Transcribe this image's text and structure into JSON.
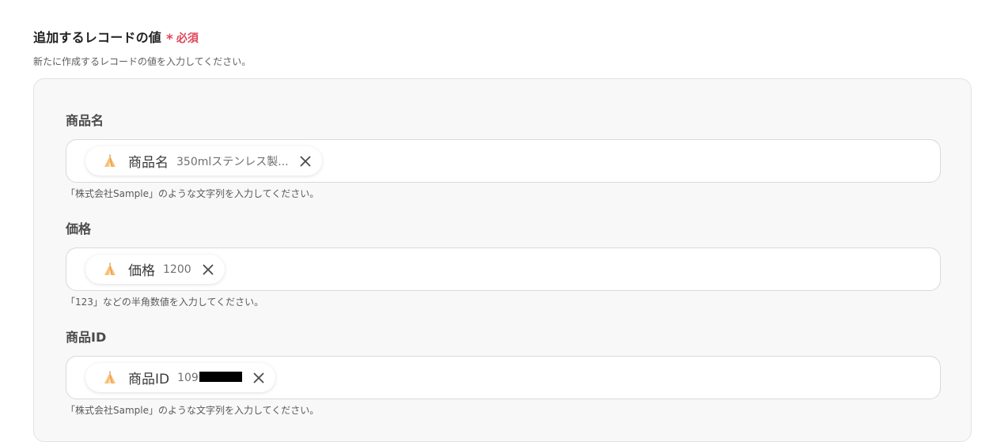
{
  "section": {
    "title": "追加するレコードの値",
    "required_mark": "*",
    "required_label": "必須",
    "description": "新たに作成するレコードの値を入力してください。"
  },
  "fields": [
    {
      "label": "商品名",
      "chip": {
        "name": "商品名",
        "value": "350mlステンレス製..."
      },
      "hint": "「株式会社Sample」のような文字列を入力してください。"
    },
    {
      "label": "価格",
      "chip": {
        "name": "価格",
        "value": "1200"
      },
      "hint": "「123」などの半角数値を入力してください。"
    },
    {
      "label": "商品ID",
      "chip": {
        "name": "商品ID",
        "value": "109",
        "redacted": true
      },
      "hint": "「株式会社Sample」のような文字列を入力してください。"
    }
  ],
  "icons": {
    "chip_icon": "tent-icon",
    "remove_icon": "close-icon"
  },
  "colors": {
    "required": "#e0485a",
    "panel_bg": "#f8f8f8",
    "tent_orange": "#f2a04a"
  }
}
